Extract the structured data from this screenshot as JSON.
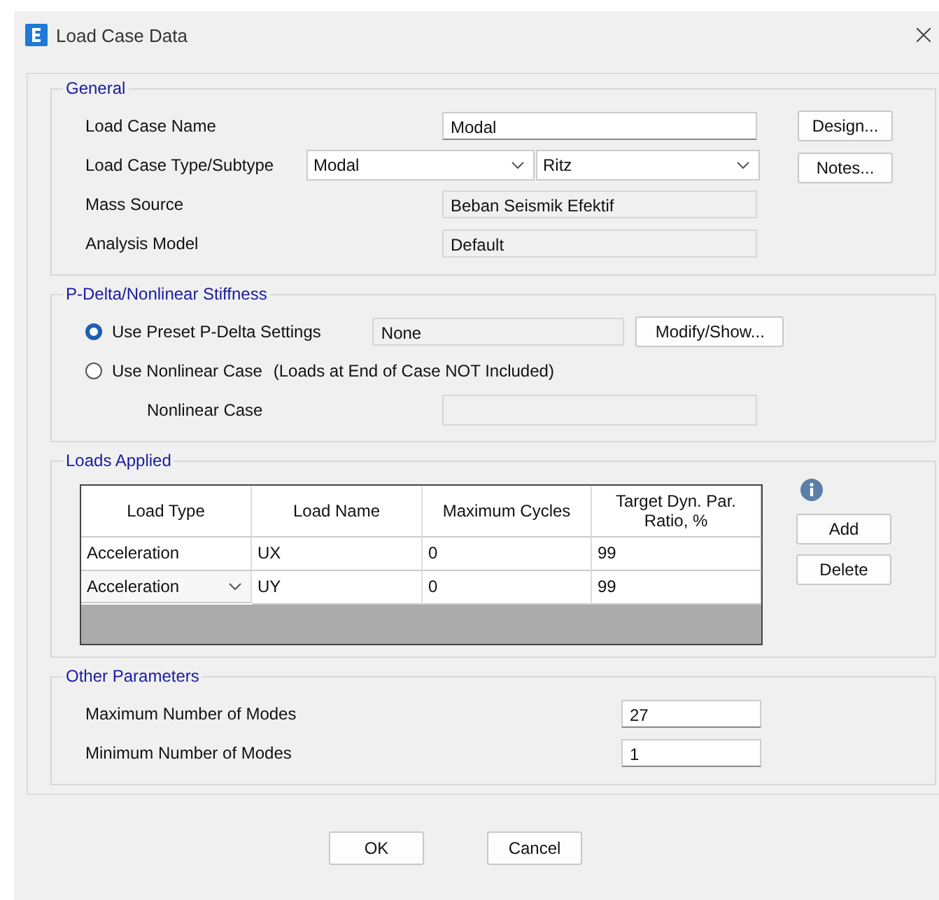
{
  "window": {
    "title": "Load Case Data"
  },
  "general": {
    "title": "General",
    "load_case_name": {
      "label": "Load Case Name",
      "value": "Modal"
    },
    "type_subtype": {
      "label": "Load Case Type/Subtype",
      "type": "Modal",
      "subtype": "Ritz"
    },
    "mass_source": {
      "label": "Mass Source",
      "value": "Beban Seismik Efektif",
      "disabled": true
    },
    "analysis_model": {
      "label": "Analysis Model",
      "value": "Default",
      "disabled": true
    },
    "buttons": [
      "Design...",
      "Notes..."
    ]
  },
  "p_delta": {
    "title": "P-Delta/Nonlinear Stiffness",
    "options": [
      {
        "label": "Use Preset P-Delta Settings",
        "selected": true,
        "value": "None",
        "button": "Modify/Show..."
      },
      {
        "label": "Use Nonlinear Case",
        "note": "(Loads at End of Case NOT Included)",
        "selected": false
      }
    ],
    "nonlinear_case": {
      "label": "Nonlinear Case",
      "disabled": true
    }
  },
  "loads_applied": {
    "title": "Loads Applied",
    "columns": [
      "Load Type",
      "Load Name",
      "Maximum Cycles",
      "Target Dyn. Par. Ratio, %"
    ],
    "rows": [
      {
        "cells": [
          "Acceleration",
          "UX",
          "0",
          "99"
        ],
        "dropdown": false
      },
      {
        "cells": [
          "Acceleration",
          "UY",
          "0",
          "99"
        ],
        "dropdown": true
      }
    ],
    "buttons": [
      "Add",
      "Delete"
    ]
  },
  "other_parameters": {
    "title": "Other Parameters",
    "params": [
      {
        "label": "Maximum Number of Modes",
        "value": "27"
      },
      {
        "label": "Minimum Number of Modes",
        "value": "1"
      }
    ]
  },
  "buttons": [
    "OK",
    "Cancel"
  ]
}
